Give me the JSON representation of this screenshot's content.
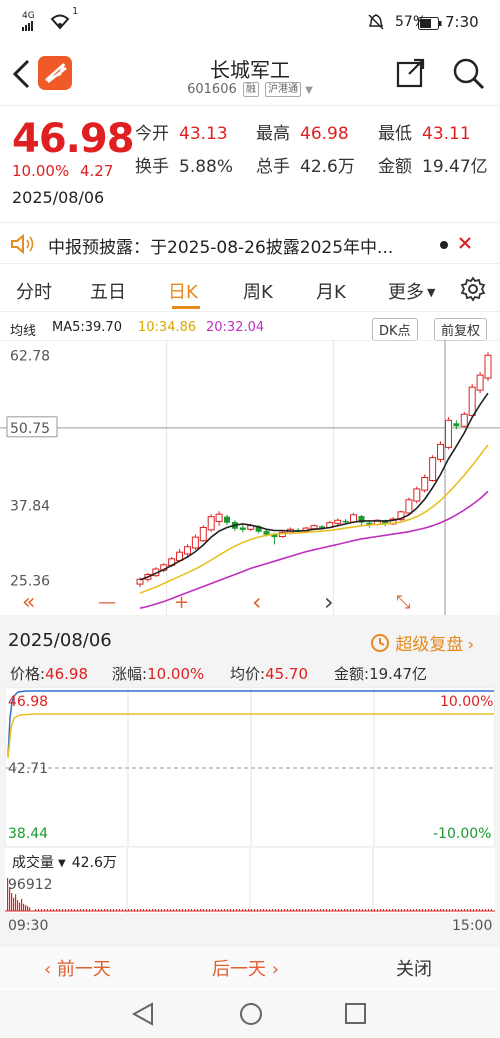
{
  "status": {
    "signal": "4G",
    "battery": "57%",
    "time": "7:30",
    "notif": "1"
  },
  "header": {
    "title": "长城军工",
    "code": "601606",
    "tag1": "融",
    "tag2": "沪港通"
  },
  "quote": {
    "price": "46.98",
    "change_pct": "10.00%",
    "change": "4.27",
    "date": "2025/08/06",
    "open_label": "今开",
    "open": "43.13",
    "high_label": "最高",
    "high": "46.98",
    "low_label": "最低",
    "low": "43.11",
    "turnover_label": "换手",
    "turnover": "5.88%",
    "volume_label": "总手",
    "volume": "42.6万",
    "amount_label": "金额",
    "amount": "19.47亿"
  },
  "notice": {
    "text": "中报预披露：于2025-08-26披露2025年中..."
  },
  "tabs": [
    {
      "label": "分时"
    },
    {
      "label": "五日"
    },
    {
      "label": "日K"
    },
    {
      "label": "周K"
    },
    {
      "label": "月K"
    },
    {
      "label": "更多"
    }
  ],
  "ma": {
    "label": "均线",
    "ma5": "MA5:39.70",
    "ma10": "10:34.86",
    "ma20": "20:32.04",
    "dk": "DK点",
    "adj": "前复权"
  },
  "colors": {
    "up": "#e02020",
    "down": "#1a9a2e",
    "ma5": "#222222",
    "ma10": "#e8c020",
    "ma20": "#c030c0",
    "accent": "#e58a1c"
  },
  "chart_data": {
    "type": "candlestick",
    "y_ticks": [
      "62.78",
      "50.75",
      "37.84",
      "25.36"
    ],
    "ylim": [
      20.5,
      64.5
    ],
    "candles": [
      [
        24.8,
        25.6,
        24.3,
        25.9,
        1
      ],
      [
        25.6,
        26.4,
        25.2,
        26.7,
        1
      ],
      [
        26.2,
        27.3,
        26.0,
        27.6,
        1
      ],
      [
        27.1,
        28.0,
        26.8,
        28.3,
        1
      ],
      [
        27.9,
        29.0,
        27.6,
        29.3,
        1
      ],
      [
        28.7,
        30.1,
        28.5,
        30.6,
        1
      ],
      [
        29.8,
        31.0,
        29.4,
        31.4,
        1
      ],
      [
        30.8,
        32.6,
        30.5,
        33.0,
        1
      ],
      [
        32.0,
        34.2,
        31.8,
        34.6,
        1
      ],
      [
        33.8,
        36.0,
        33.5,
        36.4,
        1
      ],
      [
        35.2,
        36.4,
        34.5,
        36.9,
        1
      ],
      [
        36.0,
        35.0,
        34.6,
        36.3,
        -1
      ],
      [
        35.1,
        34.0,
        33.6,
        35.4,
        -1
      ],
      [
        34.2,
        33.8,
        33.4,
        34.6,
        -1
      ],
      [
        33.9,
        34.5,
        33.6,
        34.8,
        1
      ],
      [
        34.4,
        33.5,
        33.2,
        34.6,
        -1
      ],
      [
        33.6,
        33.0,
        32.7,
        33.8,
        -1
      ],
      [
        33.1,
        32.6,
        31.4,
        33.3,
        -1
      ],
      [
        32.7,
        33.4,
        32.5,
        33.6,
        1
      ],
      [
        33.3,
        33.9,
        33.1,
        34.2,
        1
      ],
      [
        33.8,
        33.6,
        33.3,
        34.1,
        -1
      ],
      [
        33.6,
        34.1,
        33.4,
        34.3,
        1
      ],
      [
        34.0,
        34.5,
        33.8,
        34.7,
        1
      ],
      [
        34.4,
        34.2,
        34.0,
        34.6,
        -1
      ],
      [
        34.2,
        35.0,
        34.0,
        35.3,
        1
      ],
      [
        34.9,
        35.4,
        34.6,
        35.7,
        1
      ],
      [
        35.3,
        35.1,
        34.8,
        35.6,
        -1
      ],
      [
        35.1,
        36.3,
        34.9,
        36.6,
        1
      ],
      [
        36.1,
        35.0,
        34.6,
        36.3,
        -1
      ],
      [
        35.0,
        34.6,
        34.2,
        35.3,
        -1
      ],
      [
        34.7,
        35.4,
        34.5,
        35.6,
        1
      ],
      [
        35.3,
        34.8,
        34.4,
        35.5,
        -1
      ],
      [
        34.8,
        35.6,
        34.6,
        35.9,
        1
      ],
      [
        35.5,
        36.8,
        35.3,
        37.0,
        1
      ],
      [
        36.6,
        38.8,
        36.4,
        39.2,
        1
      ],
      [
        38.6,
        40.6,
        38.2,
        41.0,
        1
      ],
      [
        40.4,
        42.5,
        40.0,
        43.0,
        1
      ],
      [
        42.0,
        45.8,
        41.8,
        46.2,
        1
      ],
      [
        45.5,
        48.0,
        45.0,
        48.5,
        1
      ],
      [
        47.5,
        52.0,
        47.2,
        52.5,
        1
      ],
      [
        51.5,
        51.0,
        50.5,
        52.0,
        -1
      ],
      [
        51.0,
        53.0,
        50.8,
        53.4,
        1
      ],
      [
        52.8,
        57.5,
        52.5,
        58.0,
        1
      ],
      [
        57.0,
        59.5,
        56.5,
        60.0,
        1
      ],
      [
        59.0,
        62.8,
        58.5,
        63.3,
        1
      ]
    ],
    "ma5": [
      25.5,
      26.0,
      26.6,
      27.2,
      27.9,
      28.6,
      29.3,
      30.2,
      31.3,
      32.6,
      33.6,
      34.2,
      34.6,
      34.8,
      34.6,
      34.3,
      33.9,
      33.7,
      33.7,
      33.6,
      33.6,
      33.7,
      33.9,
      34.0,
      34.2,
      34.5,
      34.8,
      35.1,
      35.3,
      35.3,
      35.3,
      35.3,
      35.4,
      35.7,
      36.3,
      37.4,
      38.9,
      40.8,
      43.0,
      45.6,
      47.7,
      49.9,
      52.5,
      54.6,
      56.5
    ],
    "ma10": [
      23.3,
      23.8,
      24.3,
      24.9,
      25.5,
      26.1,
      26.7,
      27.3,
      28.0,
      28.8,
      29.6,
      30.4,
      31.1,
      31.7,
      32.2,
      32.6,
      32.9,
      33.1,
      33.2,
      33.2,
      33.3,
      33.4,
      33.5,
      33.6,
      33.7,
      33.9,
      34.1,
      34.3,
      34.5,
      34.6,
      34.7,
      34.8,
      34.9,
      35.1,
      35.5,
      36.0,
      36.7,
      37.6,
      38.7,
      40.0,
      41.4,
      42.9,
      44.5,
      46.2,
      47.9
    ],
    "ma20": [
      20.8,
      21.1,
      21.5,
      21.9,
      22.4,
      22.9,
      23.4,
      23.9,
      24.4,
      24.9,
      25.4,
      25.9,
      26.4,
      26.9,
      27.4,
      27.8,
      28.2,
      28.6,
      29.0,
      29.4,
      29.8,
      30.2,
      30.5,
      30.8,
      31.1,
      31.4,
      31.7,
      32.0,
      32.3,
      32.5,
      32.7,
      32.9,
      33.1,
      33.3,
      33.5,
      33.8,
      34.1,
      34.5,
      35.0,
      35.6,
      36.3,
      37.1,
      38.0,
      39.0,
      40.2
    ]
  },
  "controls": {
    "left": "«",
    "minus": "—",
    "plus": "+",
    "prev": "‹",
    "next": "›",
    "expand": "⤡"
  },
  "mini": {
    "date": "2025/08/06",
    "super": "超级复盘",
    "price_label": "价格:",
    "price": "46.98",
    "pct_label": "涨幅:",
    "pct": "10.00%",
    "avg_label": "均价:",
    "avg": "45.70",
    "amount_label": "金额:",
    "amount": "19.47亿",
    "top_price": "46.98",
    "mid_price": "42.71",
    "bot_price": "38.44",
    "top_pct": "10.00%",
    "bot_pct": "-10.00%",
    "vol_label": "成交量",
    "vol_value": "42.6万",
    "vol_max": "96912",
    "t_open": "09:30",
    "t_close": "15:00"
  },
  "bottom": {
    "prev": "前一天",
    "next": "后一天",
    "close": "关闭"
  }
}
